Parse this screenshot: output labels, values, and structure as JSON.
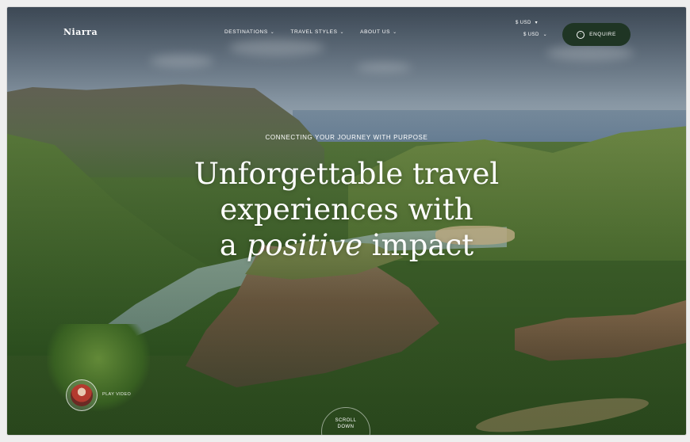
{
  "brand": {
    "logo": "Niarra"
  },
  "nav": {
    "items": [
      {
        "label": "DESTINATIONS"
      },
      {
        "label": "TRAVEL STYLES"
      },
      {
        "label": "ABOUT US"
      }
    ],
    "chevron": "⌄"
  },
  "currency": {
    "primary": "$ USD",
    "primary_arrow": "▾",
    "secondary": "$ USD",
    "secondary_arrow": "⌄"
  },
  "enquire": {
    "label": "ENQUIRE",
    "icon": "chat-icon"
  },
  "hero": {
    "eyebrow": "CONNECTING YOUR JOURNEY WITH PURPOSE",
    "line1": "Unforgettable travel",
    "line2": "experiences with",
    "line3_pre": "a ",
    "line3_em": "positive",
    "line3_post": " impact"
  },
  "video": {
    "label": "PLAY VIDEO"
  },
  "scroll": {
    "line1": "SCROLL",
    "line2": "DOWN"
  },
  "colors": {
    "enquire_bg": "#1f3524",
    "text": "#ffffff"
  }
}
